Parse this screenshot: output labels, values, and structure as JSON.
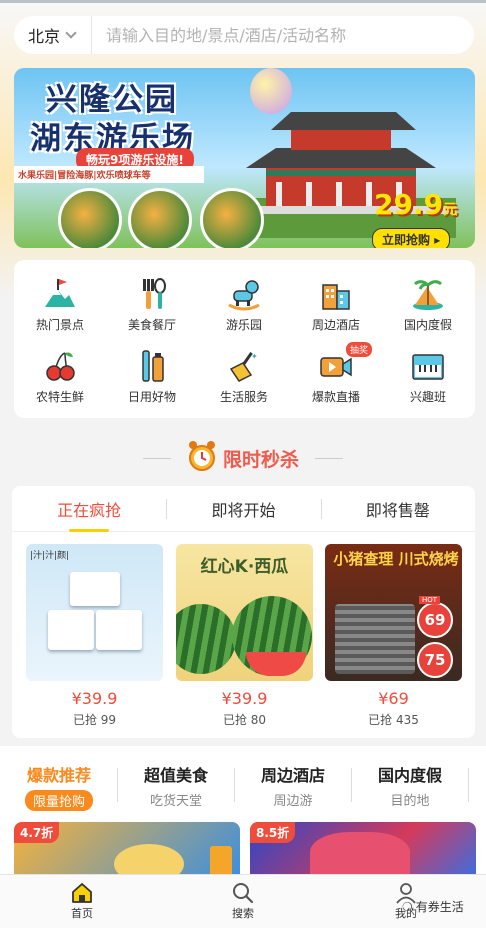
{
  "search": {
    "city": "北京",
    "placeholder": "请输入目的地/景点/酒店/活动名称"
  },
  "banner": {
    "title_line1": "兴隆公园",
    "title_line2": "湖东游乐场",
    "ribbon": "畅玩9项游乐设施!",
    "subtitle": "水果乐园|冒险海豚|欢乐喷球车等",
    "price": "29.9",
    "price_unit": "元",
    "cta": "立即抢购"
  },
  "categories": [
    {
      "label": "热门景点",
      "icon": "mountain-flag-icon"
    },
    {
      "label": "美食餐厅",
      "icon": "fork-spoon-icon"
    },
    {
      "label": "游乐园",
      "icon": "rocking-horse-icon"
    },
    {
      "label": "周边酒店",
      "icon": "buildings-icon"
    },
    {
      "label": "国内度假",
      "icon": "island-palm-icon"
    },
    {
      "label": "农特生鲜",
      "icon": "cherry-icon"
    },
    {
      "label": "日用好物",
      "icon": "toothbrush-icon"
    },
    {
      "label": "生活服务",
      "icon": "broom-icon"
    },
    {
      "label": "爆款直播",
      "icon": "video-camera-icon",
      "badge": "抽奖"
    },
    {
      "label": "兴趣班",
      "icon": "piano-icon"
    }
  ],
  "flash_sale": {
    "title": "限时秒杀",
    "tabs": [
      "正在疯抢",
      "即将开始",
      "即将售罄"
    ],
    "products": [
      {
        "image_text": "|汁|汁|颜|",
        "price": "¥39.9",
        "sold": "已抢 99"
      },
      {
        "image_text": "红心K·西瓜",
        "price": "¥39.9",
        "sold": "已抢 80"
      },
      {
        "image_text": "小猪查理 川式烧烤",
        "price": "¥69",
        "sold": "已抢 435",
        "badge_top": "69",
        "badge_bottom": "75",
        "badge_label": "HOT"
      }
    ]
  },
  "recommend_tabs": [
    {
      "title": "爆款推荐",
      "sub": "限量抢购"
    },
    {
      "title": "超值美食",
      "sub": "吃货天堂"
    },
    {
      "title": "周边酒店",
      "sub": "周边游"
    },
    {
      "title": "国内度假",
      "sub": "目的地"
    }
  ],
  "cards": [
    {
      "discount": "4.7折"
    },
    {
      "discount": "8.5折"
    }
  ],
  "bottom_nav": [
    {
      "label": "首页",
      "icon": "home-icon"
    },
    {
      "label": "搜索",
      "icon": "search-icon"
    },
    {
      "label": "我的",
      "icon": "user-icon"
    }
  ],
  "watermark": "有券生活",
  "colors": {
    "accent": "#f04c3b",
    "orange": "#f98a1e",
    "yellow": "#f9d100"
  }
}
